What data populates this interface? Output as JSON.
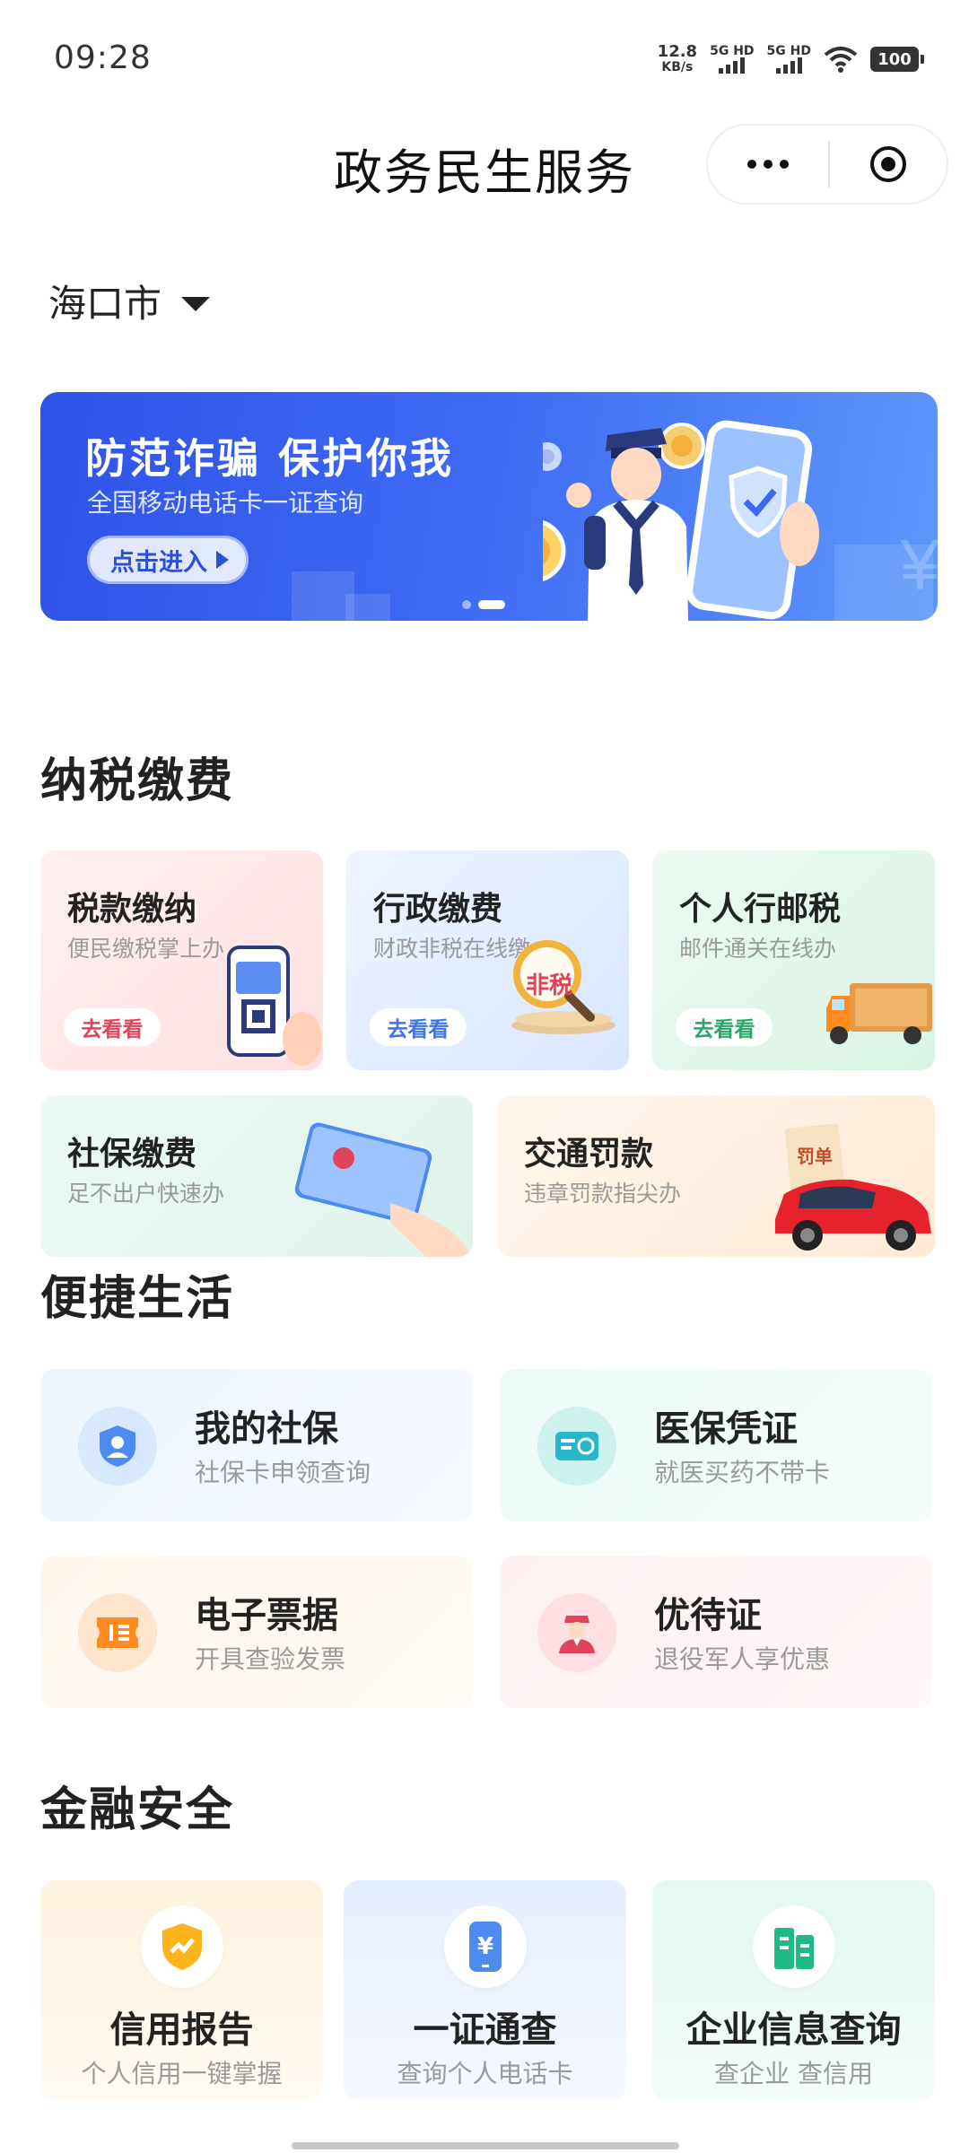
{
  "status_bar": {
    "time": "09:28",
    "net_speed_value": "12.8",
    "net_speed_unit": "KB/s",
    "sim1_label": "5G HD",
    "sim2_label": "5G HD",
    "battery": "100"
  },
  "nav": {
    "title": "政务民生服务"
  },
  "city": {
    "name": "海口市"
  },
  "banner": {
    "title": "防范诈骗 保护你我",
    "subtitle": "全国移动电话卡一证查询",
    "button_label": "点击进入",
    "page_count": 2,
    "active_page": 2
  },
  "tax_section": {
    "title": "纳税缴费",
    "cards": [
      {
        "title": "税款缴纳",
        "subtitle": "便民缴税掌上办",
        "action": "去看看",
        "action_color": "#e0435a"
      },
      {
        "title": "行政缴费",
        "subtitle": "财政非税在线缴",
        "action": "去看看",
        "action_color": "#3d74e6"
      },
      {
        "title": "个人行邮税",
        "subtitle": "邮件通关在线办",
        "action": "去看看",
        "action_color": "#29a565"
      },
      {
        "title": "社保缴费",
        "subtitle": "足不出户快速办"
      },
      {
        "title": "交通罚款",
        "subtitle": "违章罚款指尖办"
      }
    ],
    "art_labels": {
      "magnifier_text": "非税",
      "ticket_text": "罚单"
    }
  },
  "life_section": {
    "title": "便捷生活",
    "cards": [
      {
        "title": "我的社保",
        "subtitle": "社保卡申领查询",
        "icon": "shield-user-icon"
      },
      {
        "title": "医保凭证",
        "subtitle": "就医买药不带卡",
        "icon": "medical-card-icon"
      },
      {
        "title": "电子票据",
        "subtitle": "开具查验发票",
        "icon": "receipt-icon"
      },
      {
        "title": "优待证",
        "subtitle": "退役军人享优惠",
        "icon": "soldier-icon"
      }
    ]
  },
  "finance_section": {
    "title": "金融安全",
    "cards": [
      {
        "title": "信用报告",
        "subtitle": "个人信用一键掌握",
        "icon": "credit-shield-icon"
      },
      {
        "title": "一证通查",
        "subtitle": "查询个人电话卡",
        "icon": "phone-yuan-icon",
        "icon_text": "¥"
      },
      {
        "title": "企业信息查询",
        "subtitle": "查企业 查信用",
        "icon": "building-icon"
      }
    ]
  },
  "colors": {
    "banner_blue": "#3d68f3",
    "text_primary": "#222222",
    "text_secondary": "#9a9a9a"
  }
}
